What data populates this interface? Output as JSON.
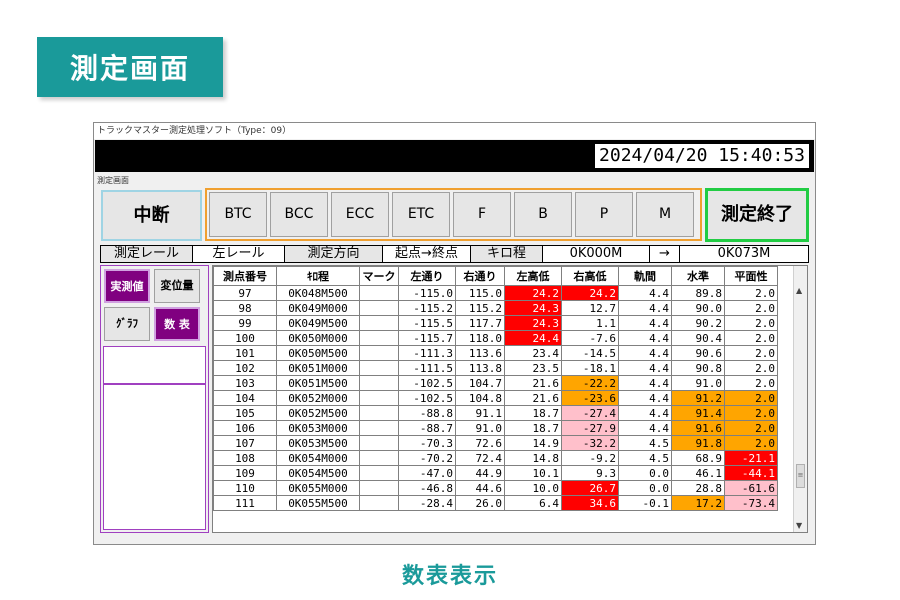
{
  "page_title": "測定画面",
  "caption": "数表表示",
  "window": {
    "title": "トラックマスター測定処理ソフト（Type：09）",
    "datetime": "2024/04/20 15:40:53",
    "screen_label": "測定画面"
  },
  "buttons": {
    "suspend": "中断",
    "end": "測定終了",
    "modes": [
      "BTC",
      "BCC",
      "ECC",
      "ETC",
      "F",
      "B",
      "P",
      "M"
    ]
  },
  "info": {
    "rail_label": "測定レール",
    "rail_value": "左レール",
    "direction_label": "測定方向",
    "direction_value": "起点→終点",
    "km_label": "キロ程",
    "km_from": "0K000M",
    "arrow": "→",
    "km_to": "0K073M"
  },
  "side": {
    "actual": "実測値",
    "displacement": "変位量",
    "graph": "ｸﾞﾗﾌ",
    "table": "数 表"
  },
  "colors": {
    "teal": "#1a9a9a",
    "red": "#ff0000",
    "orange": "#ffa500",
    "pink": "#ffc0cb",
    "purple": "#800080",
    "green": "#22cc44"
  },
  "table": {
    "headers": [
      "測点番号",
      "ｷﾛ程",
      "マーク",
      "左通り",
      "右通り",
      "左高低",
      "右高低",
      "軌間",
      "水準",
      "平面性"
    ],
    "rows": [
      [
        "97",
        "0K048M500",
        "",
        "-115.0",
        "115.0",
        "24.2",
        "24.2",
        "4.4",
        "89.8",
        "2.0"
      ],
      [
        "98",
        "0K049M000",
        "",
        "-115.2",
        "115.2",
        "24.3",
        "12.7",
        "4.4",
        "90.0",
        "2.0"
      ],
      [
        "99",
        "0K049M500",
        "",
        "-115.5",
        "117.7",
        "24.3",
        "1.1",
        "4.4",
        "90.2",
        "2.0"
      ],
      [
        "100",
        "0K050M000",
        "",
        "-115.7",
        "118.0",
        "24.4",
        "-7.6",
        "4.4",
        "90.4",
        "2.0"
      ],
      [
        "101",
        "0K050M500",
        "",
        "-111.3",
        "113.6",
        "23.4",
        "-14.5",
        "4.4",
        "90.6",
        "2.0"
      ],
      [
        "102",
        "0K051M000",
        "",
        "-111.5",
        "113.8",
        "23.5",
        "-18.1",
        "4.4",
        "90.8",
        "2.0"
      ],
      [
        "103",
        "0K051M500",
        "",
        "-102.5",
        "104.7",
        "21.6",
        "-22.2",
        "4.4",
        "91.0",
        "2.0"
      ],
      [
        "104",
        "0K052M000",
        "",
        "-102.5",
        "104.8",
        "21.6",
        "-23.6",
        "4.4",
        "91.2",
        "2.0"
      ],
      [
        "105",
        "0K052M500",
        "",
        "-88.8",
        "91.1",
        "18.7",
        "-27.4",
        "4.4",
        "91.4",
        "2.0"
      ],
      [
        "106",
        "0K053M000",
        "",
        "-88.7",
        "91.0",
        "18.7",
        "-27.9",
        "4.4",
        "91.6",
        "2.0"
      ],
      [
        "107",
        "0K053M500",
        "",
        "-70.3",
        "72.6",
        "14.9",
        "-32.2",
        "4.5",
        "91.8",
        "2.0"
      ],
      [
        "108",
        "0K054M000",
        "",
        "-70.2",
        "72.4",
        "14.8",
        "-9.2",
        "4.5",
        "68.9",
        "-21.1"
      ],
      [
        "109",
        "0K054M500",
        "",
        "-47.0",
        "44.9",
        "10.1",
        "9.3",
        "0.0",
        "46.1",
        "-44.1"
      ],
      [
        "110",
        "0K055M000",
        "",
        "-46.8",
        "44.6",
        "10.0",
        "26.7",
        "0.0",
        "28.8",
        "-61.6"
      ],
      [
        "111",
        "0K055M500",
        "",
        "-28.4",
        "26.0",
        "6.4",
        "34.6",
        "-0.1",
        "17.2",
        "-73.4"
      ]
    ],
    "highlights": [
      [
        "",
        "",
        "",
        "",
        "",
        "red",
        "red",
        "",
        "",
        ""
      ],
      [
        "",
        "",
        "",
        "",
        "",
        "red",
        "",
        "",
        "",
        ""
      ],
      [
        "",
        "",
        "",
        "",
        "",
        "red",
        "",
        "",
        "",
        ""
      ],
      [
        "",
        "",
        "",
        "",
        "",
        "red",
        "",
        "",
        "",
        ""
      ],
      [
        "",
        "",
        "",
        "",
        "",
        "",
        "",
        "",
        "",
        ""
      ],
      [
        "",
        "",
        "",
        "",
        "",
        "",
        "",
        "",
        "",
        ""
      ],
      [
        "",
        "",
        "",
        "",
        "",
        "",
        "orange",
        "",
        "",
        ""
      ],
      [
        "",
        "",
        "",
        "",
        "",
        "",
        "orange",
        "",
        "orange",
        "orange"
      ],
      [
        "",
        "",
        "",
        "",
        "",
        "",
        "pink",
        "",
        "orange",
        "orange"
      ],
      [
        "",
        "",
        "",
        "",
        "",
        "",
        "pink",
        "",
        "orange",
        "orange"
      ],
      [
        "",
        "",
        "",
        "",
        "",
        "",
        "pink",
        "",
        "orange",
        "orange"
      ],
      [
        "",
        "",
        "",
        "",
        "",
        "",
        "",
        "",
        "",
        "red"
      ],
      [
        "",
        "",
        "",
        "",
        "",
        "",
        "",
        "",
        "",
        "red"
      ],
      [
        "",
        "",
        "",
        "",
        "",
        "",
        "red",
        "",
        "",
        "pink"
      ],
      [
        "",
        "",
        "",
        "",
        "",
        "",
        "red",
        "",
        "orange",
        "pink"
      ]
    ]
  }
}
